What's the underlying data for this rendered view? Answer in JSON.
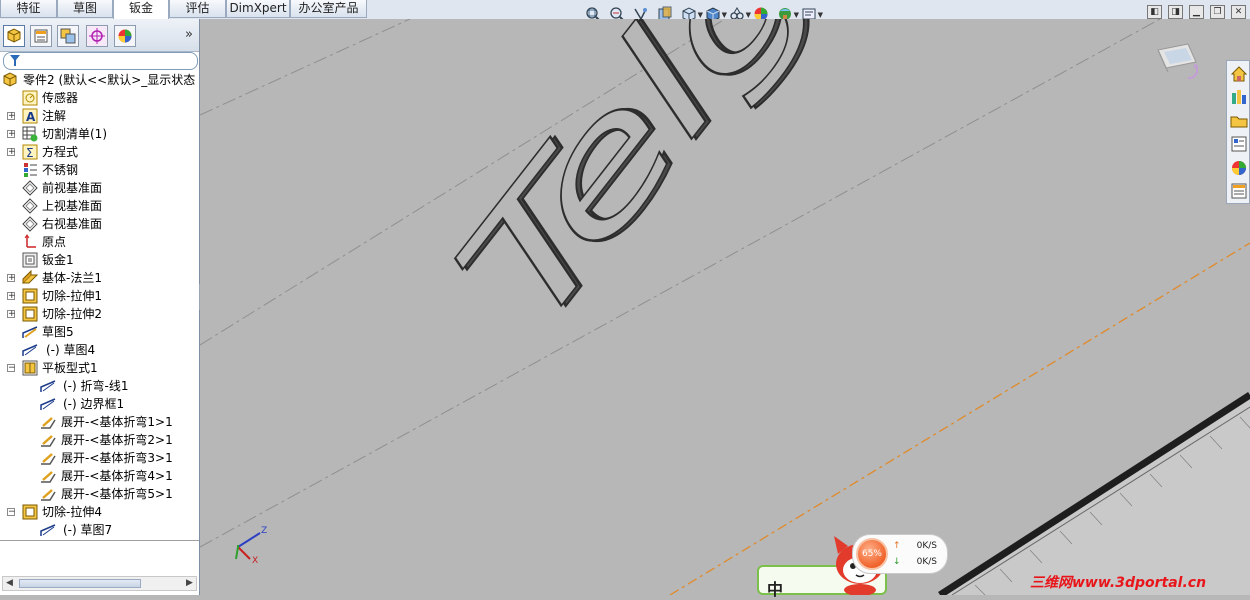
{
  "tabs": [
    "特征",
    "草图",
    "钣金",
    "评估",
    "DimXpert",
    "办公室产品"
  ],
  "active_tab": "钣金",
  "view_toolbar": {
    "icons": [
      "zoom-to-fit-icon",
      "zoom-to-area-icon",
      "previous-view-icon",
      "section-view-icon",
      "view-orientation-icon",
      "display-style-icon",
      "hide-show-items-icon",
      "edit-appearance-icon",
      "apply-scene-icon",
      "view-settings-icon"
    ]
  },
  "feature_tree": {
    "root": "零件2   (默认<<默认>_显示状态",
    "items": [
      {
        "label": "传感器",
        "icon": "sensor-icon"
      },
      {
        "label": "注解",
        "icon": "annotation-icon"
      },
      {
        "label": "切割清单(1)",
        "icon": "cut-list-icon"
      },
      {
        "label": "方程式",
        "icon": "equation-icon"
      },
      {
        "label": "不锈钢",
        "icon": "material-icon"
      },
      {
        "label": "前视基准面",
        "icon": "plane-icon"
      },
      {
        "label": "上视基准面",
        "icon": "plane-icon"
      },
      {
        "label": "右视基准面",
        "icon": "plane-icon"
      },
      {
        "label": "原点",
        "icon": "origin-icon"
      },
      {
        "label": "钣金1",
        "icon": "sheet-metal-icon"
      },
      {
        "label": "基体-法兰1",
        "icon": "base-flange-icon"
      },
      {
        "label": "切除-拉伸1",
        "icon": "cut-extrude-icon"
      },
      {
        "label": "切除-拉伸2",
        "icon": "cut-extrude-icon"
      },
      {
        "label": "草图5",
        "icon": "sketch-icon"
      },
      {
        "label": "(-) 草图4",
        "icon": "sketch-icon"
      },
      {
        "label": "平板型式1",
        "icon": "flat-pattern-icon"
      },
      {
        "label": "(-) 折弯-线1",
        "icon": "sketch-icon"
      },
      {
        "label": "(-) 边界框1",
        "icon": "sketch-icon"
      },
      {
        "label": "展开-<基体折弯1>1",
        "icon": "unfold-icon"
      },
      {
        "label": "展开-<基体折弯2>1",
        "icon": "unfold-icon"
      },
      {
        "label": "展开-<基体折弯3>1",
        "icon": "unfold-icon"
      },
      {
        "label": "展开-<基体折弯4>1",
        "icon": "unfold-icon"
      },
      {
        "label": "展开-<基体折弯5>1",
        "icon": "unfold-icon"
      },
      {
        "label": "切除-拉伸4",
        "icon": "cut-extrude-icon"
      },
      {
        "label": "(-) 草图7",
        "icon": "sketch-icon"
      }
    ]
  },
  "viewport": {
    "engraved_text": "Telga",
    "background_color": "#b7b7b7"
  },
  "net_monitor": {
    "percent": "65%",
    "upload": "0K/S",
    "download": "0K/S"
  },
  "ime": {
    "text": "中"
  },
  "watermark": "三维网www.3dportal.cn"
}
